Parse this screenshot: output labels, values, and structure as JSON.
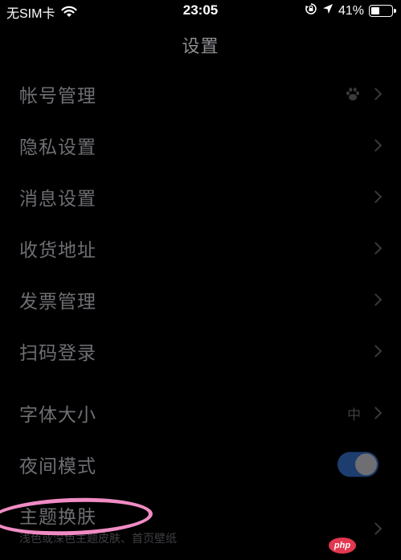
{
  "status_bar": {
    "carrier": "无SIM卡",
    "time": "23:05",
    "battery_percent": "41%",
    "battery_level": 0.41,
    "icons": [
      "wifi-icon",
      "orientation-lock-icon",
      "location-arrow-icon",
      "battery-icon"
    ]
  },
  "nav": {
    "title": "设置"
  },
  "group1": {
    "rows": [
      {
        "label": "帐号管理",
        "icon": "baidu-paw-icon"
      },
      {
        "label": "隐私设置"
      },
      {
        "label": "消息设置"
      },
      {
        "label": "收货地址"
      },
      {
        "label": "发票管理"
      },
      {
        "label": "扫码登录"
      }
    ]
  },
  "group2": {
    "font_size": {
      "label": "字体大小",
      "value": "中"
    },
    "night_mode": {
      "label": "夜间模式",
      "on": true
    },
    "theme": {
      "label": "主题换肤",
      "subtitle": "浅色或深色主题皮肤、首页壁纸"
    }
  },
  "watermark": {
    "text": "php"
  },
  "colors": {
    "background": "#000000",
    "toggle_on": "#1c3d6e",
    "highlight": "#f08cc4",
    "watermark": "#e2374f"
  }
}
